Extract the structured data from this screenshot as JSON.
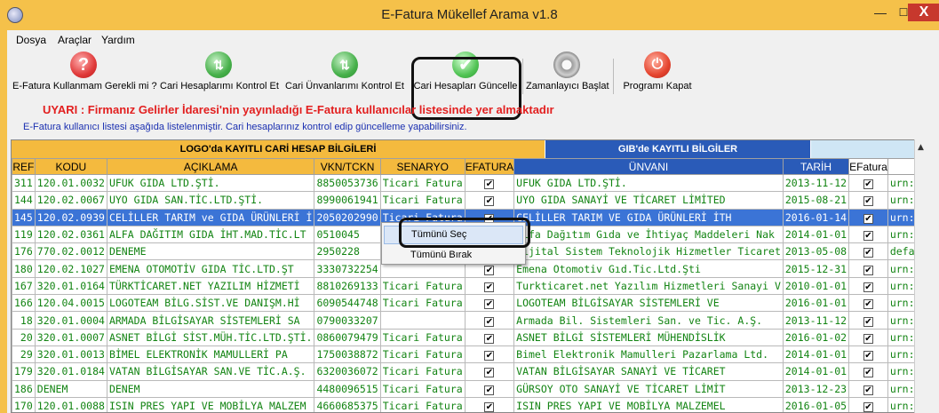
{
  "window": {
    "title": "E-Fatura Mükellef Arama  v1.8",
    "min": "—",
    "max": "☐",
    "close": "X"
  },
  "menu": [
    "Dosya",
    "Araçlar",
    "Yardım"
  ],
  "toolbar": [
    {
      "label": "E-Fatura Kullanmam Gerekli mi ?",
      "icon": "question-icon"
    },
    {
      "label": "Cari Hesaplarımı Kontrol Et",
      "icon": "refresh-icon"
    },
    {
      "label": "Cari Ünvanlarımı Kontrol Et",
      "icon": "refresh-icon"
    },
    {
      "label": "Cari Hesapları Güncelle",
      "icon": "check-icon"
    },
    {
      "label": "Zamanlayıcı Başlat",
      "icon": "gear-icon"
    },
    {
      "label": "Programı Kapat",
      "icon": "power-icon"
    }
  ],
  "warning": "UYARI : Firmanız Gelirler İdaresi'nin yayınladığı E-Fatura kullanıcılar listesinde yer almaktadır",
  "info": "E-Fatura kullanıcı listesi aşağıda listelenmiştir. Cari hesaplarınız kontrol edip güncelleme yapabilirsiniz.",
  "grid": {
    "group_logo": "LOGO'da KAYITLI CARİ HESAP BİLGİLERİ",
    "group_gib": "GIB'de KAYITLI BİLGİLER",
    "columns": [
      "REF",
      "KODU",
      "AÇIKLAMA",
      "VKN/TCKN",
      "SENARYO",
      "EFATURA",
      "ÜNVANI",
      "TARİH",
      "EFatura",
      ""
    ],
    "rows": [
      [
        "311",
        "120.01.0032",
        "UFUK GIDA LTD.ŞTİ.",
        "8850053736",
        "Ticari Fatura",
        "✔",
        "UFUK GIDA LTD.ŞTİ.",
        "2013-11-12",
        "✔",
        "urn:mail:uf"
      ],
      [
        "144",
        "120.02.0067",
        "UYO GIDA SAN.TİC.LTD.ŞTİ.",
        "8990061941",
        "Ticari Fatura",
        "✔",
        "UYO GIDA SANAYİ VE TİCARET LİMİTED",
        "2015-08-21",
        "✔",
        "urn:mail:de"
      ],
      [
        "145",
        "120.02.0939",
        "CELİLLER TARIM ve GIDA ÜRÜNLERİ İ",
        "2050202990",
        "Ticari Fatura",
        "✔",
        "CELİLLER TARIM VE GIDA ÜRÜNLERİ İTH",
        "2016-01-14",
        "✔",
        "urn:mail:de"
      ],
      [
        "119",
        "120.02.0361",
        "ALFA DAĞITIM GIDA İHT.MAD.TİC.LT",
        "0510045",
        "",
        "",
        "Alfa Dağıtım Gıda ve İhtiyaç Maddeleri Nak",
        "2014-01-01",
        "✔",
        "urn:mail:de"
      ],
      [
        "176",
        "770.02.0012",
        "DENEME",
        "2950228",
        "",
        "",
        "Dijital Sistem Teknolojik Hizmetler Ticaret",
        "2013-05-08",
        "✔",
        "defaultpk"
      ],
      [
        "180",
        "120.02.1027",
        "EMENA OTOMOTİV GIDA TİC.LTD.ŞT",
        "3330732254",
        "",
        "✔",
        "Emena Otomotiv Gıd.Tic.Ltd.Şti",
        "2015-12-31",
        "✔",
        "urn:mail:de"
      ],
      [
        "167",
        "320.01.0164",
        "TÜRKTİCARET.NET YAZILIM HİZMETİ",
        "8810269133",
        "Ticari Fatura",
        "✔",
        "Turkticaret.net Yazılım Hizmetleri Sanayi V",
        "2010-01-01",
        "✔",
        "urn:mail:de"
      ],
      [
        "166",
        "120.04.0015",
        "LOGOTEAM BİLG.SİST.VE DANIŞM.Hİ",
        "6090544748",
        "Ticari Fatura",
        "✔",
        "LOGOTEAM BİLGİSAYAR SİSTEMLERİ VE",
        "2016-01-01",
        "✔",
        "urn:mail:de"
      ],
      [
        "18",
        "320.01.0004",
        "ARMADA BİLGİSAYAR SİSTEMLERİ SA",
        "0790033207",
        "",
        "✔",
        "Armada Bil. Sistemleri San. ve Tic. A.Ş.",
        "2013-11-12",
        "✔",
        "urn:mail:de"
      ],
      [
        "20",
        "320.01.0007",
        "ASNET BİLGİ SİST.MÜH.TİC.LTD.ŞTİ.",
        "0860079479",
        "Ticari Fatura",
        "✔",
        "ASNET BİLGİ SİSTEMLERİ MÜHENDİSLİK",
        "2016-01-02",
        "✔",
        "urn:mail:de"
      ],
      [
        "29",
        "320.01.0013",
        "BİMEL ELEKTRONİK MAMULLERİ PA",
        "1750038872",
        "Ticari Fatura",
        "✔",
        "Bimel Elektronik Mamulleri Pazarlama Ltd.",
        "2014-01-01",
        "✔",
        "urn:mail:de"
      ],
      [
        "179",
        "320.01.0184",
        "VATAN BİLGİSAYAR SAN.VE TİC.A.Ş.",
        "6320036072",
        "Ticari Fatura",
        "✔",
        "VATAN BİLGİSAYAR SANAYİ VE TİCARET",
        "2014-01-01",
        "✔",
        "urn:mail:de"
      ],
      [
        "186",
        "DENEM",
        "DENEM",
        "4480096515",
        "Ticari Fatura",
        "✔",
        "GÜRSOY OTO SANAYİ VE TİCARET LİMİT",
        "2013-12-23",
        "✔",
        "urn:mail:de"
      ],
      [
        "170",
        "120.01.0088",
        "ISIN PRES YAPI VE MOBİLYA MALZEM",
        "4660685375",
        "Ticari Fatura",
        "✔",
        "ISIN PRES YAPI VE MOBİLYA MALZEMEL",
        "2016-01-05",
        "✔",
        "urn:mail:de"
      ]
    ],
    "selected_row": 2
  },
  "context_menu": [
    "Tümünü Seç",
    "Tümünü Bırak"
  ]
}
